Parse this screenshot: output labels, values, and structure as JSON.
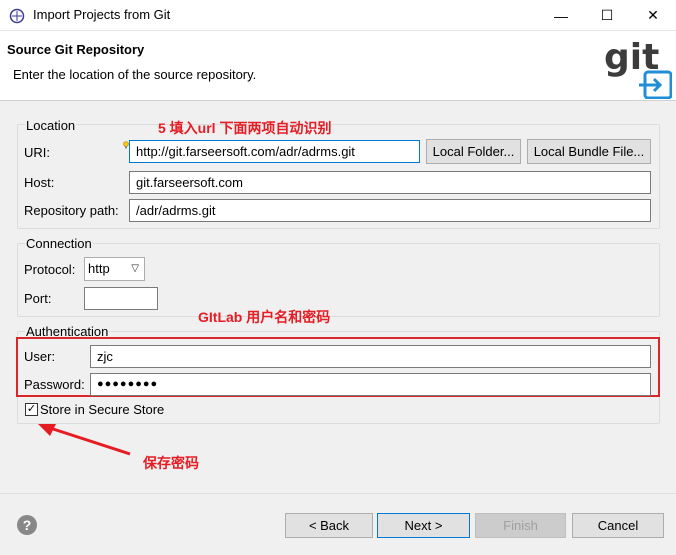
{
  "window": {
    "title": "Import Projects from Git",
    "minimize_glyph": "—",
    "maximize_glyph": "☐",
    "close_glyph": "✕"
  },
  "header": {
    "title": "Source Git Repository",
    "description": "Enter the location of the source repository.",
    "logo_text": "git"
  },
  "location": {
    "group_label": "Location",
    "uri_label": "URI:",
    "uri_value": "http://git.farseersoft.com/adr/adrms.git",
    "local_folder_button": "Local Folder...",
    "local_bundle_button": "Local Bundle File...",
    "host_label": "Host:",
    "host_value": "git.farseersoft.com",
    "repo_path_label": "Repository path:",
    "repo_path_value": "/adr/adrms.git"
  },
  "connection": {
    "group_label": "Connection",
    "protocol_label": "Protocol:",
    "protocol_value": "http",
    "port_label": "Port:",
    "port_value": ""
  },
  "authentication": {
    "group_label": "Authentication",
    "user_label": "User:",
    "user_value": "zjc",
    "password_label": "Password:",
    "password_value": "●●●●●●●●",
    "store_label": "Store in Secure Store",
    "store_checked": "✓"
  },
  "annotations": {
    "step_note": "5 填入url 下面两项自动识别",
    "gitlab_note": "GItLab 用户名和密码",
    "save_note": "保存密码"
  },
  "footer": {
    "help_glyph": "?",
    "back_button": "< Back",
    "next_button": "Next >",
    "finish_button": "Finish",
    "cancel_button": "Cancel"
  },
  "colors": {
    "annotation_red": "#e51c23",
    "focus_blue": "#0078d7",
    "git_logo_gray": "#3c3c3c",
    "git_logo_blue": "#1f8ed6"
  }
}
